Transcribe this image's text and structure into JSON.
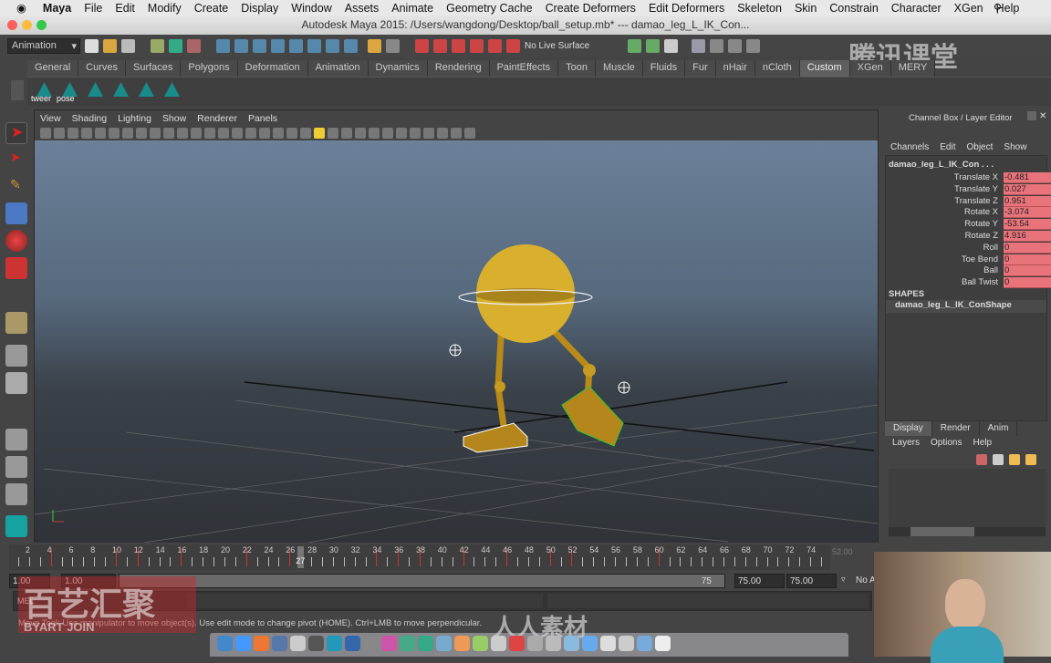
{
  "menubar": {
    "apple": "",
    "items": [
      "Maya",
      "File",
      "Edit",
      "Modify",
      "Create",
      "Display",
      "Window",
      "Assets",
      "Animate",
      "Geometry Cache",
      "Create Deformers",
      "Edit Deformers",
      "Skeleton",
      "Skin",
      "Constrain",
      "Character",
      "XGen",
      "Help"
    ]
  },
  "window": {
    "title": "Autodesk Maya 2015: /Users/wangdong/Desktop/ball_setup.mb*  ---  damao_leg_L_IK_Con..."
  },
  "status_line": {
    "mode": "Animation",
    "live_surface": "No Live Surface"
  },
  "shelf": {
    "tabs": [
      "General",
      "Curves",
      "Surfaces",
      "Polygons",
      "Deformation",
      "Animation",
      "Dynamics",
      "Rendering",
      "PaintEffects",
      "Toon",
      "Muscle",
      "Fluids",
      "Fur",
      "nHair",
      "nCloth",
      "Custom",
      "XGen",
      "MERY"
    ],
    "active": "Custom",
    "buttons": [
      "tweer",
      "pose",
      "",
      "",
      "",
      ""
    ]
  },
  "viewport": {
    "menu": [
      "View",
      "Shading",
      "Lighting",
      "Show",
      "Renderer",
      "Panels"
    ]
  },
  "channel_box": {
    "title": "Channel Box / Layer Editor",
    "menu": [
      "Channels",
      "Edit",
      "Object",
      "Show"
    ],
    "object": "damao_leg_L_IK_Con . . .",
    "attributes": [
      {
        "name": "Translate X",
        "value": "-0.481"
      },
      {
        "name": "Translate Y",
        "value": "0.027"
      },
      {
        "name": "Translate Z",
        "value": "0.951"
      },
      {
        "name": "Rotate X",
        "value": "-3.074"
      },
      {
        "name": "Rotate Y",
        "value": "-53.54"
      },
      {
        "name": "Rotate Z",
        "value": "4.916"
      },
      {
        "name": "Roll",
        "value": "0"
      },
      {
        "name": "Toe Bend",
        "value": "0"
      },
      {
        "name": "Ball",
        "value": "0"
      },
      {
        "name": "Ball Twist",
        "value": "0"
      }
    ],
    "shapes_label": "SHAPES",
    "shape": "damao_leg_L_IK_ConShape",
    "key_color": "#e8737a"
  },
  "layer_editor": {
    "tabs": [
      "Display",
      "Render",
      "Anim"
    ],
    "active": "Display",
    "menu": [
      "Layers",
      "Options",
      "Help"
    ]
  },
  "timeline": {
    "start": 1,
    "end": 75,
    "current_frame": "27",
    "keys": [
      4,
      10,
      12,
      16,
      22,
      26,
      34,
      36,
      38,
      42,
      46,
      50,
      52,
      60
    ],
    "end_field": "52.00"
  },
  "range": {
    "start": "1.00",
    "range_start": "1.00",
    "range_end": "75",
    "end": "75.00",
    "end2": "75.00",
    "anim_layer": "No A"
  },
  "command_line": {
    "lang": "MEL"
  },
  "help_line": "Move Tool: Use manipulator to move object(s). Use edit mode to change pivot (HOME).  Ctrl+LMB to move perpendicular.",
  "watermarks": {
    "top_right": "腾讯课堂",
    "bottom_left": "百艺汇聚",
    "bottom_left_en": "BYART JOIN",
    "center": "人人素材"
  }
}
